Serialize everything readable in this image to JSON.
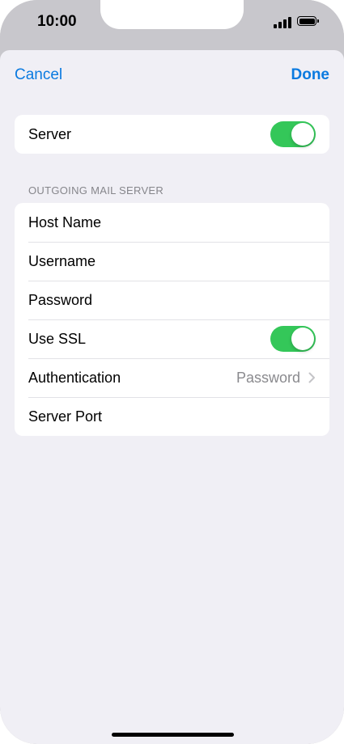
{
  "status_bar": {
    "time": "10:00"
  },
  "nav": {
    "cancel_label": "Cancel",
    "done_label": "Done"
  },
  "server_card": {
    "label": "Server",
    "toggle_on": true
  },
  "outgoing": {
    "header": "OUTGOING MAIL SERVER",
    "rows": [
      {
        "label": "Host Name"
      },
      {
        "label": "Username"
      },
      {
        "label": "Password"
      },
      {
        "label": "Use SSL",
        "toggle_on": true
      },
      {
        "label": "Authentication",
        "value": "Password"
      },
      {
        "label": "Server Port"
      }
    ]
  },
  "colors": {
    "accent": "#0a7ae0",
    "toggle_on": "#34c759",
    "background": "#f0eff5"
  }
}
